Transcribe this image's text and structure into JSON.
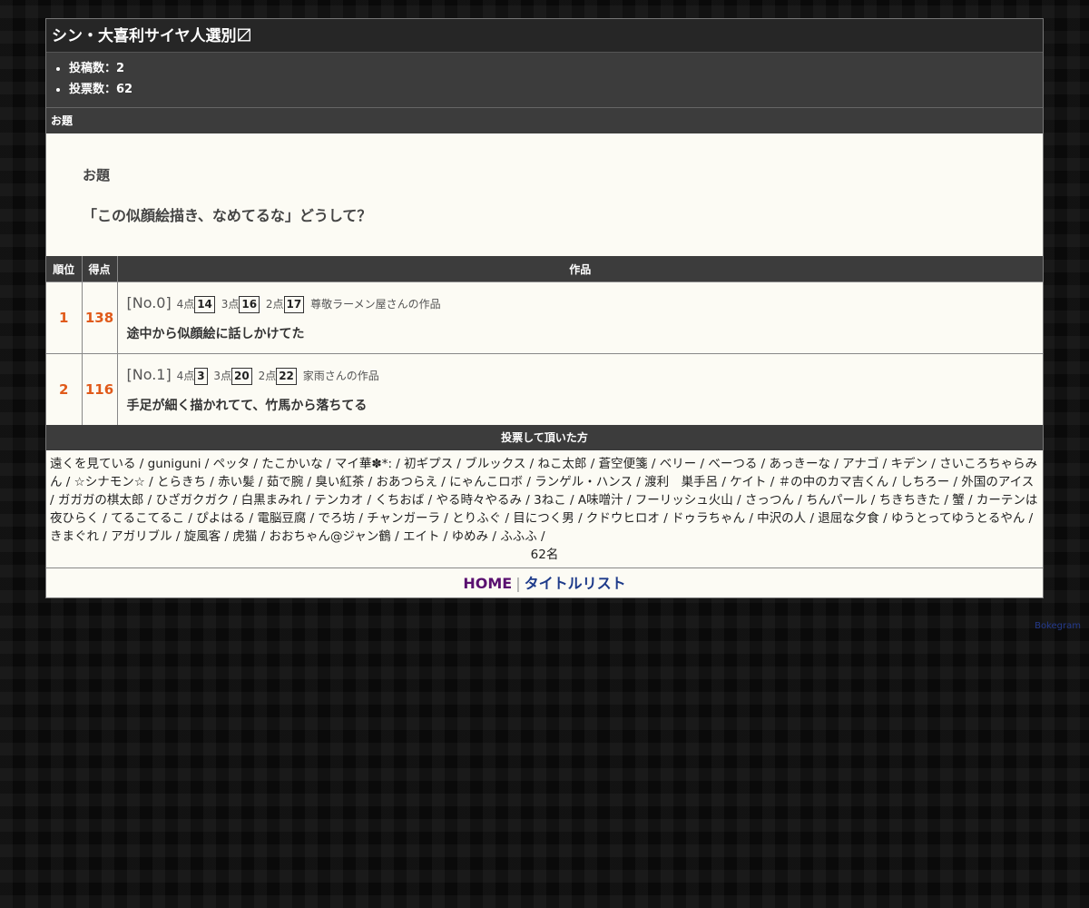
{
  "page": {
    "title": "シン・大喜利サイヤ人選別〼"
  },
  "stats": [
    "投稿数：2",
    "投票数：62"
  ],
  "theme": {
    "section_label": "お題",
    "label": "お題",
    "text": "「この似顔絵描き、なめてるな」どうして？"
  },
  "results": {
    "headers": {
      "rank": "順位",
      "score": "得点",
      "work": "作品"
    },
    "rows": [
      {
        "rank": "1",
        "score": "138",
        "no": "[No.0]",
        "p4_label": "4点",
        "p4": "14",
        "p3_label": "3点",
        "p3": "16",
        "p2_label": "2点",
        "p2": "17",
        "author": "尊敬ラーメン屋さんの作品",
        "text": "途中から似顔絵に話しかけてた"
      },
      {
        "rank": "2",
        "score": "116",
        "no": "[No.1]",
        "p4_label": "4点",
        "p4": "3",
        "p3_label": "3点",
        "p3": "20",
        "p2_label": "2点",
        "p2": "22",
        "author": "家雨さんの作品",
        "text": "手足が細く描かれてて、竹馬から落ちてる"
      }
    ]
  },
  "voters": {
    "header": "投票して頂いた方",
    "list": "遠くを見ている / guniguni / ペッタ / たこかいな / マイ華✽*: / 初ギプス / ブルックス / ねこ太郎 / 蒼空便箋 / ベリー / べーつる / あっきーな / アナゴ / キデン / さいころちゃらみん / ☆シナモン☆ / とらきち / 赤い髪 / 茹で腕 / 臭い紅茶 / おあつらえ / にゃんこロボ / ランゲル・ハンス / 渡利　巣手呂 / ケイト / ＃の中のカマ吉くん / しちろー / 外国のアイス / ガガガの棋太郎 / ひざガクガク / 白黒まみれ / テンカオ / くちおば / やる時々やるみ / 3ねこ / A味噌汁 / フーリッシュ火山 / さっつん / ちんパール / ちきちきた / 蟹 / カーテンは夜ひらく / てるこてるこ / ぴよはる / 電脳豆腐 / でろ坊 / チャンガーラ / とりふぐ / 目につく男 / クドウヒロオ / ドゥラちゃん / 中沢の人 / 退屈な夕食 / ゆうとってゆうとるやん / きまぐれ / アガリブル / 旋風客 / 虎猫 / おおちゃん@ジャン鶴 / エイト / ゆめみ / ふふふ /",
    "count": "62名"
  },
  "footer": {
    "home": "HOME",
    "separator": "|",
    "list": "タイトルリスト"
  },
  "brand": "Bokegram",
  "colors": {
    "accent": "#e05a1a",
    "header_bg": "#3c3c3c",
    "home_link": "#5a1070",
    "list_link": "#1e3b8a"
  }
}
